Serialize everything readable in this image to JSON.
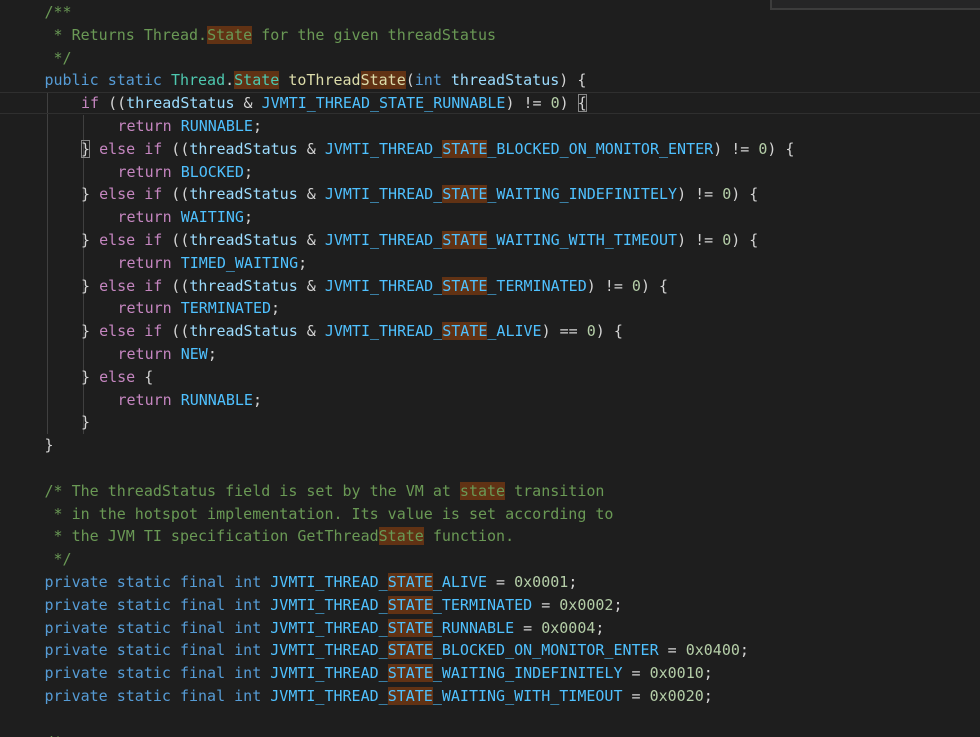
{
  "editor": {
    "language": "java",
    "colors": {
      "background": "#1e1e1e",
      "keyword": "#569cd6",
      "control": "#c586c0",
      "type": "#4ec9b0",
      "function": "#dcdcaa",
      "variable": "#9cdcfe",
      "constant": "#4fc1ff",
      "number": "#b5cea8",
      "comment": "#6a9955",
      "plain": "#d4d4d4",
      "find_highlight": "#613214"
    },
    "lines": [
      {
        "indent": 1,
        "tokens": [
          [
            "/**",
            "com"
          ]
        ]
      },
      {
        "indent": 1,
        "tokens": [
          [
            " * Returns Thread.",
            "com"
          ],
          [
            "State",
            "com",
            1
          ],
          [
            " for the given threadStatus",
            "com"
          ]
        ]
      },
      {
        "indent": 1,
        "tokens": [
          [
            " */",
            "com"
          ]
        ]
      },
      {
        "indent": 1,
        "tokens": [
          [
            "public",
            "kw"
          ],
          [
            " ",
            "pl"
          ],
          [
            "static",
            "kw"
          ],
          [
            " ",
            "pl"
          ],
          [
            "Thread",
            "ty"
          ],
          [
            ".",
            "pl"
          ],
          [
            "State",
            "ty",
            1
          ],
          [
            " ",
            "pl"
          ],
          [
            "toThread",
            "fn"
          ],
          [
            "State",
            "fn",
            1
          ],
          [
            "(",
            "pl"
          ],
          [
            "int",
            "kw"
          ],
          [
            " ",
            "pl"
          ],
          [
            "threadStatus",
            "vr"
          ],
          [
            ") {",
            "pl"
          ]
        ]
      },
      {
        "indent": 2,
        "current": true,
        "tokens": [
          [
            "if",
            "ctl"
          ],
          [
            " ((",
            "pl"
          ],
          [
            "threadStatus",
            "vr"
          ],
          [
            " & ",
            "pl"
          ],
          [
            "JVMTI_THREAD_STATE_RUNNABLE",
            "cst"
          ],
          [
            ") != ",
            "pl"
          ],
          [
            "0",
            "num"
          ],
          [
            ") ",
            "pl"
          ],
          [
            "{",
            "pl",
            0,
            1
          ]
        ]
      },
      {
        "indent": 3,
        "tokens": [
          [
            "return",
            "ctl"
          ],
          [
            " ",
            "pl"
          ],
          [
            "RUNNABLE",
            "cst"
          ],
          [
            ";",
            "pl"
          ]
        ]
      },
      {
        "indent": 2,
        "tokens": [
          [
            "}",
            "pl",
            0,
            1
          ],
          [
            " ",
            "pl"
          ],
          [
            "else",
            "ctl"
          ],
          [
            " ",
            "pl"
          ],
          [
            "if",
            "ctl"
          ],
          [
            " ((",
            "pl"
          ],
          [
            "threadStatus",
            "vr"
          ],
          [
            " & ",
            "pl"
          ],
          [
            "JVMTI_THREAD_",
            "cst"
          ],
          [
            "STATE",
            "cst",
            1
          ],
          [
            "_BLOCKED_ON_MONITOR_ENTER",
            "cst"
          ],
          [
            ") != ",
            "pl"
          ],
          [
            "0",
            "num"
          ],
          [
            ") {",
            "pl"
          ]
        ]
      },
      {
        "indent": 3,
        "tokens": [
          [
            "return",
            "ctl"
          ],
          [
            " ",
            "pl"
          ],
          [
            "BLOCKED",
            "cst"
          ],
          [
            ";",
            "pl"
          ]
        ]
      },
      {
        "indent": 2,
        "tokens": [
          [
            "} ",
            "pl"
          ],
          [
            "else",
            "ctl"
          ],
          [
            " ",
            "pl"
          ],
          [
            "if",
            "ctl"
          ],
          [
            " ((",
            "pl"
          ],
          [
            "threadStatus",
            "vr"
          ],
          [
            " & ",
            "pl"
          ],
          [
            "JVMTI_THREAD_",
            "cst"
          ],
          [
            "STATE",
            "cst",
            1
          ],
          [
            "_WAITING_INDEFINITELY",
            "cst"
          ],
          [
            ") != ",
            "pl"
          ],
          [
            "0",
            "num"
          ],
          [
            ") {",
            "pl"
          ]
        ]
      },
      {
        "indent": 3,
        "tokens": [
          [
            "return",
            "ctl"
          ],
          [
            " ",
            "pl"
          ],
          [
            "WAITING",
            "cst"
          ],
          [
            ";",
            "pl"
          ]
        ]
      },
      {
        "indent": 2,
        "tokens": [
          [
            "} ",
            "pl"
          ],
          [
            "else",
            "ctl"
          ],
          [
            " ",
            "pl"
          ],
          [
            "if",
            "ctl"
          ],
          [
            " ((",
            "pl"
          ],
          [
            "threadStatus",
            "vr"
          ],
          [
            " & ",
            "pl"
          ],
          [
            "JVMTI_THREAD_",
            "cst"
          ],
          [
            "STATE",
            "cst",
            1
          ],
          [
            "_WAITING_WITH_TIMEOUT",
            "cst"
          ],
          [
            ") != ",
            "pl"
          ],
          [
            "0",
            "num"
          ],
          [
            ") {",
            "pl"
          ]
        ]
      },
      {
        "indent": 3,
        "tokens": [
          [
            "return",
            "ctl"
          ],
          [
            " ",
            "pl"
          ],
          [
            "TIMED_WAITING",
            "cst"
          ],
          [
            ";",
            "pl"
          ]
        ]
      },
      {
        "indent": 2,
        "tokens": [
          [
            "} ",
            "pl"
          ],
          [
            "else",
            "ctl"
          ],
          [
            " ",
            "pl"
          ],
          [
            "if",
            "ctl"
          ],
          [
            " ((",
            "pl"
          ],
          [
            "threadStatus",
            "vr"
          ],
          [
            " & ",
            "pl"
          ],
          [
            "JVMTI_THREAD_",
            "cst"
          ],
          [
            "STATE",
            "cst",
            1
          ],
          [
            "_TERMINATED",
            "cst"
          ],
          [
            ") != ",
            "pl"
          ],
          [
            "0",
            "num"
          ],
          [
            ") {",
            "pl"
          ]
        ]
      },
      {
        "indent": 3,
        "tokens": [
          [
            "return",
            "ctl"
          ],
          [
            " ",
            "pl"
          ],
          [
            "TERMINATED",
            "cst"
          ],
          [
            ";",
            "pl"
          ]
        ]
      },
      {
        "indent": 2,
        "tokens": [
          [
            "} ",
            "pl"
          ],
          [
            "else",
            "ctl"
          ],
          [
            " ",
            "pl"
          ],
          [
            "if",
            "ctl"
          ],
          [
            " ((",
            "pl"
          ],
          [
            "threadStatus",
            "vr"
          ],
          [
            " & ",
            "pl"
          ],
          [
            "JVMTI_THREAD_",
            "cst"
          ],
          [
            "STATE",
            "cst",
            1
          ],
          [
            "_ALIVE",
            "cst"
          ],
          [
            ") == ",
            "pl"
          ],
          [
            "0",
            "num"
          ],
          [
            ") {",
            "pl"
          ]
        ]
      },
      {
        "indent": 3,
        "tokens": [
          [
            "return",
            "ctl"
          ],
          [
            " ",
            "pl"
          ],
          [
            "NEW",
            "cst"
          ],
          [
            ";",
            "pl"
          ]
        ]
      },
      {
        "indent": 2,
        "tokens": [
          [
            "} ",
            "pl"
          ],
          [
            "else",
            "ctl"
          ],
          [
            " {",
            "pl"
          ]
        ]
      },
      {
        "indent": 3,
        "tokens": [
          [
            "return",
            "ctl"
          ],
          [
            " ",
            "pl"
          ],
          [
            "RUNNABLE",
            "cst"
          ],
          [
            ";",
            "pl"
          ]
        ]
      },
      {
        "indent": 2,
        "tokens": [
          [
            "}",
            "pl"
          ]
        ]
      },
      {
        "indent": 1,
        "tokens": [
          [
            "}",
            "pl"
          ]
        ]
      },
      {
        "indent": 0,
        "tokens": []
      },
      {
        "indent": 1,
        "tokens": [
          [
            "/* The threadStatus field is set by the VM at ",
            "com"
          ],
          [
            "state",
            "com",
            1
          ],
          [
            " transition",
            "com"
          ]
        ]
      },
      {
        "indent": 1,
        "tokens": [
          [
            " * in the hotspot implementation. Its value is set according to",
            "com"
          ]
        ]
      },
      {
        "indent": 1,
        "tokens": [
          [
            " * the JVM TI specification GetThread",
            "com"
          ],
          [
            "State",
            "com",
            1
          ],
          [
            " function.",
            "com"
          ]
        ]
      },
      {
        "indent": 1,
        "tokens": [
          [
            " */",
            "com"
          ]
        ]
      },
      {
        "indent": 1,
        "tokens": [
          [
            "private",
            "kw"
          ],
          [
            " ",
            "pl"
          ],
          [
            "static",
            "kw"
          ],
          [
            " ",
            "pl"
          ],
          [
            "final",
            "kw"
          ],
          [
            " ",
            "pl"
          ],
          [
            "int",
            "kw"
          ],
          [
            " ",
            "pl"
          ],
          [
            "JVMTI_THREAD_",
            "cst"
          ],
          [
            "STATE",
            "cst",
            1
          ],
          [
            "_ALIVE",
            "cst"
          ],
          [
            " = ",
            "pl"
          ],
          [
            "0x0001",
            "num"
          ],
          [
            ";",
            "pl"
          ]
        ]
      },
      {
        "indent": 1,
        "tokens": [
          [
            "private",
            "kw"
          ],
          [
            " ",
            "pl"
          ],
          [
            "static",
            "kw"
          ],
          [
            " ",
            "pl"
          ],
          [
            "final",
            "kw"
          ],
          [
            " ",
            "pl"
          ],
          [
            "int",
            "kw"
          ],
          [
            " ",
            "pl"
          ],
          [
            "JVMTI_THREAD_",
            "cst"
          ],
          [
            "STATE",
            "cst",
            1
          ],
          [
            "_TERMINATED",
            "cst"
          ],
          [
            " = ",
            "pl"
          ],
          [
            "0x0002",
            "num"
          ],
          [
            ";",
            "pl"
          ]
        ]
      },
      {
        "indent": 1,
        "tokens": [
          [
            "private",
            "kw"
          ],
          [
            " ",
            "pl"
          ],
          [
            "static",
            "kw"
          ],
          [
            " ",
            "pl"
          ],
          [
            "final",
            "kw"
          ],
          [
            " ",
            "pl"
          ],
          [
            "int",
            "kw"
          ],
          [
            " ",
            "pl"
          ],
          [
            "JVMTI_THREAD_",
            "cst"
          ],
          [
            "STATE",
            "cst",
            1
          ],
          [
            "_RUNNABLE",
            "cst"
          ],
          [
            " = ",
            "pl"
          ],
          [
            "0x0004",
            "num"
          ],
          [
            ";",
            "pl"
          ]
        ]
      },
      {
        "indent": 1,
        "tokens": [
          [
            "private",
            "kw"
          ],
          [
            " ",
            "pl"
          ],
          [
            "static",
            "kw"
          ],
          [
            " ",
            "pl"
          ],
          [
            "final",
            "kw"
          ],
          [
            " ",
            "pl"
          ],
          [
            "int",
            "kw"
          ],
          [
            " ",
            "pl"
          ],
          [
            "JVMTI_THREAD_",
            "cst"
          ],
          [
            "STATE",
            "cst",
            1
          ],
          [
            "_BLOCKED_ON_MONITOR_ENTER",
            "cst"
          ],
          [
            " = ",
            "pl"
          ],
          [
            "0x0400",
            "num"
          ],
          [
            ";",
            "pl"
          ]
        ]
      },
      {
        "indent": 1,
        "tokens": [
          [
            "private",
            "kw"
          ],
          [
            " ",
            "pl"
          ],
          [
            "static",
            "kw"
          ],
          [
            " ",
            "pl"
          ],
          [
            "final",
            "kw"
          ],
          [
            " ",
            "pl"
          ],
          [
            "int",
            "kw"
          ],
          [
            " ",
            "pl"
          ],
          [
            "JVMTI_THREAD_",
            "cst"
          ],
          [
            "STATE",
            "cst",
            1
          ],
          [
            "_WAITING_INDEFINITELY",
            "cst"
          ],
          [
            " = ",
            "pl"
          ],
          [
            "0x0010",
            "num"
          ],
          [
            ";",
            "pl"
          ]
        ]
      },
      {
        "indent": 1,
        "tokens": [
          [
            "private",
            "kw"
          ],
          [
            " ",
            "pl"
          ],
          [
            "static",
            "kw"
          ],
          [
            " ",
            "pl"
          ],
          [
            "final",
            "kw"
          ],
          [
            " ",
            "pl"
          ],
          [
            "int",
            "kw"
          ],
          [
            " ",
            "pl"
          ],
          [
            "JVMTI_THREAD_",
            "cst"
          ],
          [
            "STATE",
            "cst",
            1
          ],
          [
            "_WAITING_WITH_TIMEOUT",
            "cst"
          ],
          [
            " = ",
            "pl"
          ],
          [
            "0x0020",
            "num"
          ],
          [
            ";",
            "pl"
          ]
        ]
      },
      {
        "indent": 0,
        "tokens": []
      },
      {
        "indent": 1,
        "tokens": [
          [
            "/*",
            "com"
          ]
        ]
      }
    ]
  }
}
